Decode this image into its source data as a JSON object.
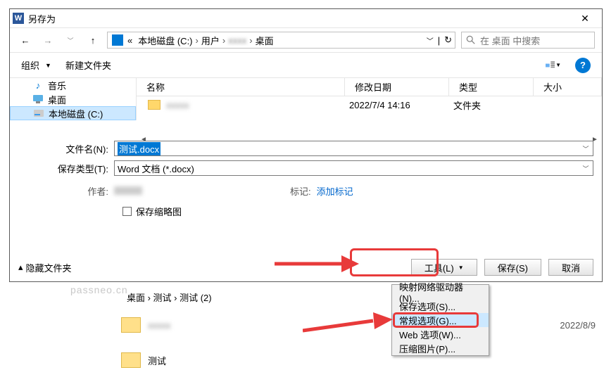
{
  "titlebar": {
    "title": "另存为"
  },
  "nav": {
    "crumbs": [
      "本地磁盘 (C:)",
      "用户",
      "",
      "桌面"
    ],
    "search_placeholder": "在 桌面 中搜索"
  },
  "headerbar": {
    "organize": "组织",
    "newfolder": "新建文件夹"
  },
  "sidebar": {
    "items": [
      {
        "label": "音乐",
        "kind": "music"
      },
      {
        "label": "桌面",
        "kind": "desktop"
      },
      {
        "label": "本地磁盘 (C:)",
        "kind": "drive"
      }
    ]
  },
  "columns": {
    "name": "名称",
    "date": "修改日期",
    "type": "类型",
    "size": "大小"
  },
  "filelist": [
    {
      "name": "",
      "date": "2022/7/4 14:16",
      "type": "文件夹"
    }
  ],
  "form": {
    "filename_label": "文件名(N):",
    "filename_value": "测试.docx",
    "filetype_label": "保存类型(T):",
    "filetype_value": "Word 文档 (*.docx)",
    "author_label": "作者:",
    "tag_label": "标记:",
    "tag_value": "添加标记",
    "thumb_label": "保存缩略图"
  },
  "bottombar": {
    "hide": "隐藏文件夹",
    "tools": "工具(L)",
    "save": "保存(S)",
    "cancel": "取消"
  },
  "tools_menu": [
    "映射网络驱动器(N)...",
    "保存选项(S)...",
    "常规选项(G)...",
    "Web 选项(W)...",
    "压缩图片(P)..."
  ],
  "background": {
    "breadcrumb": "桌面 › 测试 › 测试 (2)",
    "rows": [
      {
        "name": "",
        "date": "2022/8/9"
      },
      {
        "name": "测试"
      }
    ]
  },
  "watermark": "passneo.cn"
}
